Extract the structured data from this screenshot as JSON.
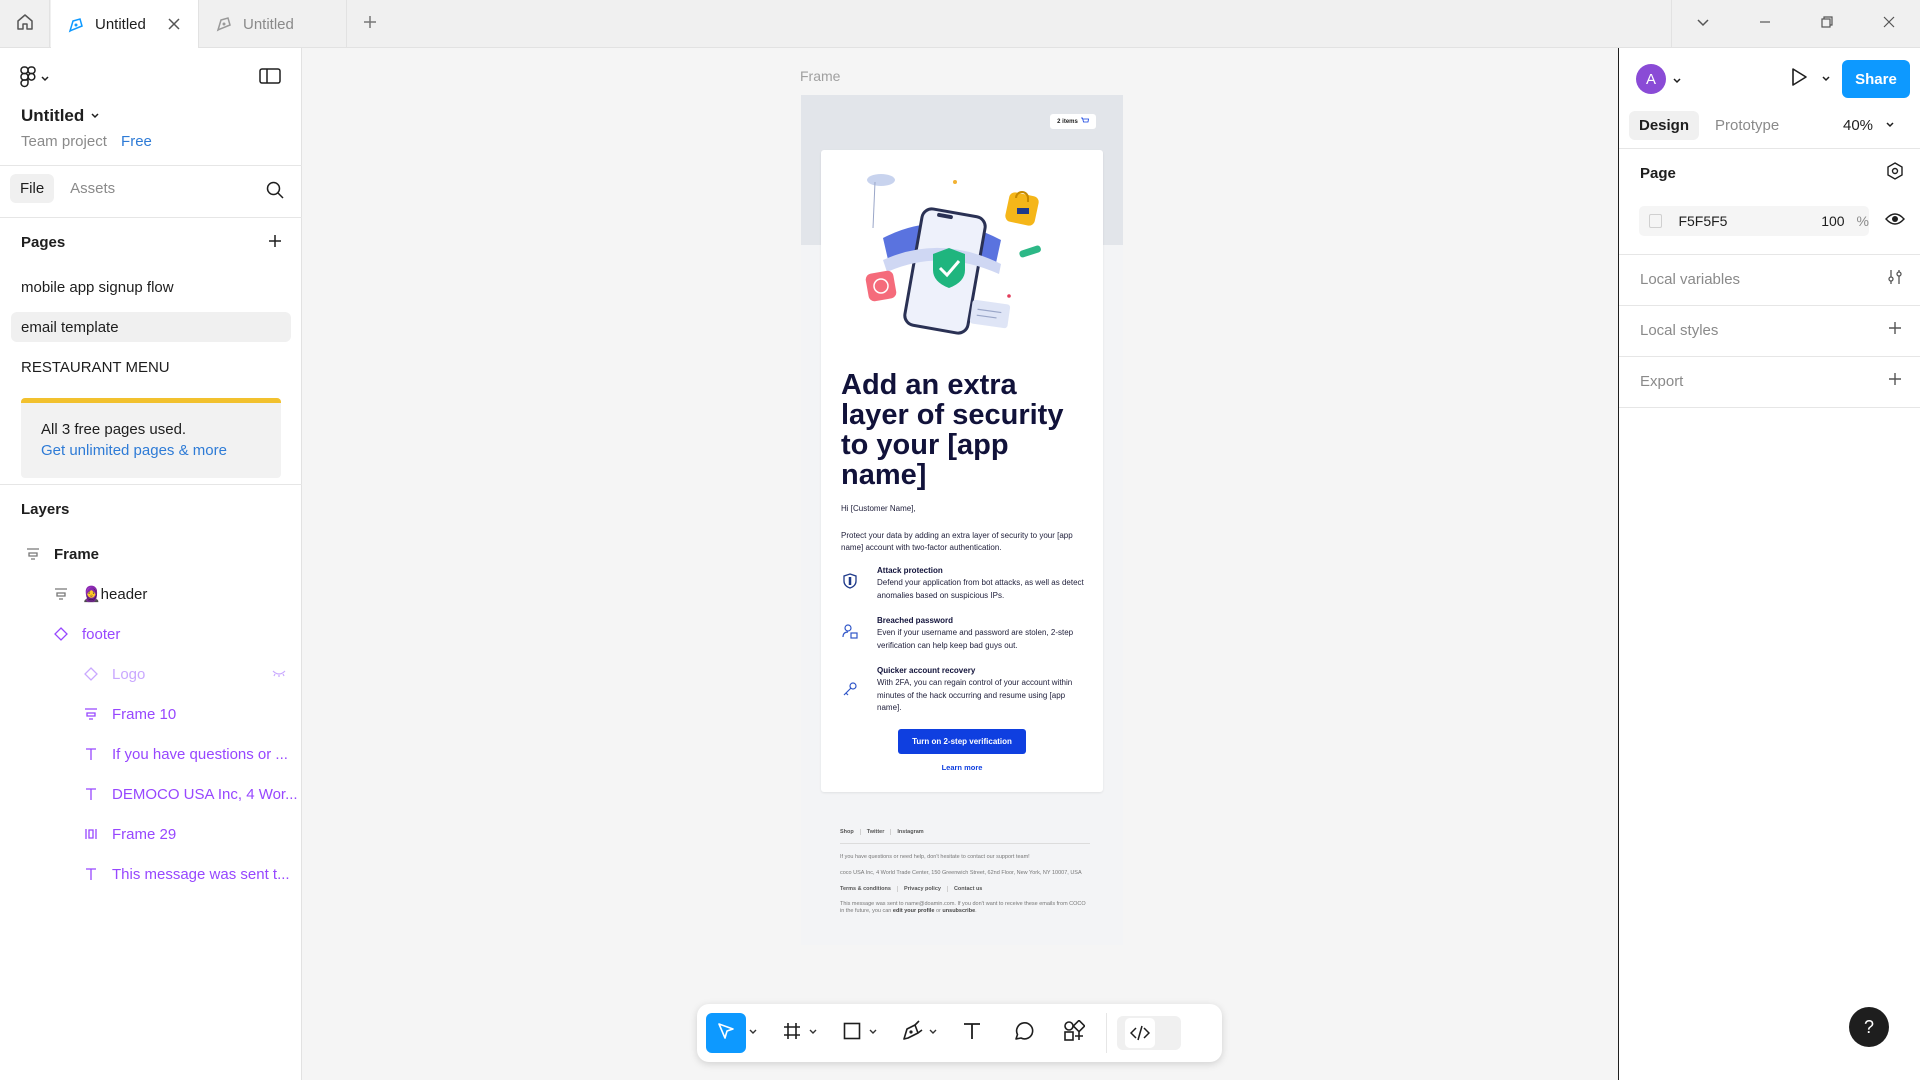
{
  "tabs": [
    {
      "title": "Untitled",
      "active": true
    },
    {
      "title": "Untitled",
      "active": false
    }
  ],
  "file": {
    "name": "Untitled",
    "team": "Team project",
    "plan": "Free"
  },
  "left_tabs": {
    "file": "File",
    "assets": "Assets"
  },
  "pages": {
    "title": "Pages",
    "items": [
      "mobile app signup flow",
      "email template",
      "RESTAURANT MENU"
    ],
    "selected": "email template"
  },
  "upgrade": {
    "line1": "All 3 free pages used.",
    "line2": "Get unlimited pages & more"
  },
  "layers": {
    "title": "Layers",
    "items": [
      {
        "label": "Frame",
        "icon": "frame-layout-icon"
      },
      {
        "label": "🧕header",
        "icon": "frame-layout-icon"
      },
      {
        "label": "footer",
        "icon": "component-instance-icon"
      },
      {
        "label": "Logo",
        "icon": "component-instance-icon",
        "hidden": true
      },
      {
        "label": "Frame 10",
        "icon": "frame-layout-icon"
      },
      {
        "label": "If you have questions or ...",
        "icon": "text-icon"
      },
      {
        "label": "DEMOCO USA Inc, 4 Wor...",
        "icon": "text-icon"
      },
      {
        "label": "Frame 29",
        "icon": "auto-layout-icon"
      },
      {
        "label": "This message was sent t...",
        "icon": "text-icon"
      }
    ]
  },
  "right": {
    "avatar": "A",
    "share": "Share",
    "tabs": {
      "design": "Design",
      "prototype": "Prototype"
    },
    "zoom": "40%",
    "page_title": "Page",
    "page_color": "F5F5F5",
    "page_opacity": "100",
    "pct": "%",
    "local_variables": "Local variables",
    "local_styles": "Local styles",
    "export": "Export"
  },
  "canvas": {
    "frame_label": "Frame"
  },
  "email": {
    "cart": "2 items",
    "headline": "Add an extra layer of security to your [app name]",
    "greeting": "Hi [Customer Name],",
    "intro": "Protect your data by adding an extra layer of security to your [app name] account with two-factor authentication.",
    "features": [
      {
        "title": "Attack protection",
        "desc": "Defend your application from bot attacks, as well as detect anomalies based on suspicious IPs."
      },
      {
        "title": "Breached password",
        "desc": "Even if your username and password are stolen, 2-step verification can help keep bad guys out."
      },
      {
        "title": "Quicker account recovery",
        "desc": "With 2FA, you can regain control of your account within minutes of the hack occurring and resume using [app name]."
      }
    ],
    "cta": "Turn on 2-step verification",
    "learn_more": "Learn more",
    "footer": {
      "links": [
        "Shop",
        "Twitter",
        "Instagram"
      ],
      "questions": "If you have questions or need help, don't hesitate to contact our support team!",
      "address": "coco USA Inc, 4 World Trade Center, 150 Greenwich Street, 62nd Floor, New York, NY 10007, USA",
      "legal_links": [
        "Terms & conditions",
        "Privacy policy",
        "Contact us"
      ],
      "sent_prefix": "This message was sent to name@doamin.com. If you don't want to receive these emails from COCO in the future, you can ",
      "edit_profile": "edit your profile",
      "or": " or ",
      "unsubscribe": "unsubscribe",
      "period": "."
    }
  },
  "help": "?",
  "colors": {
    "accent": "#0d99ff",
    "layer_purple": "#9747ff",
    "cta_blue": "#0f3fe0",
    "headline": "#11123a",
    "warning_bar": "#f2c12e"
  }
}
